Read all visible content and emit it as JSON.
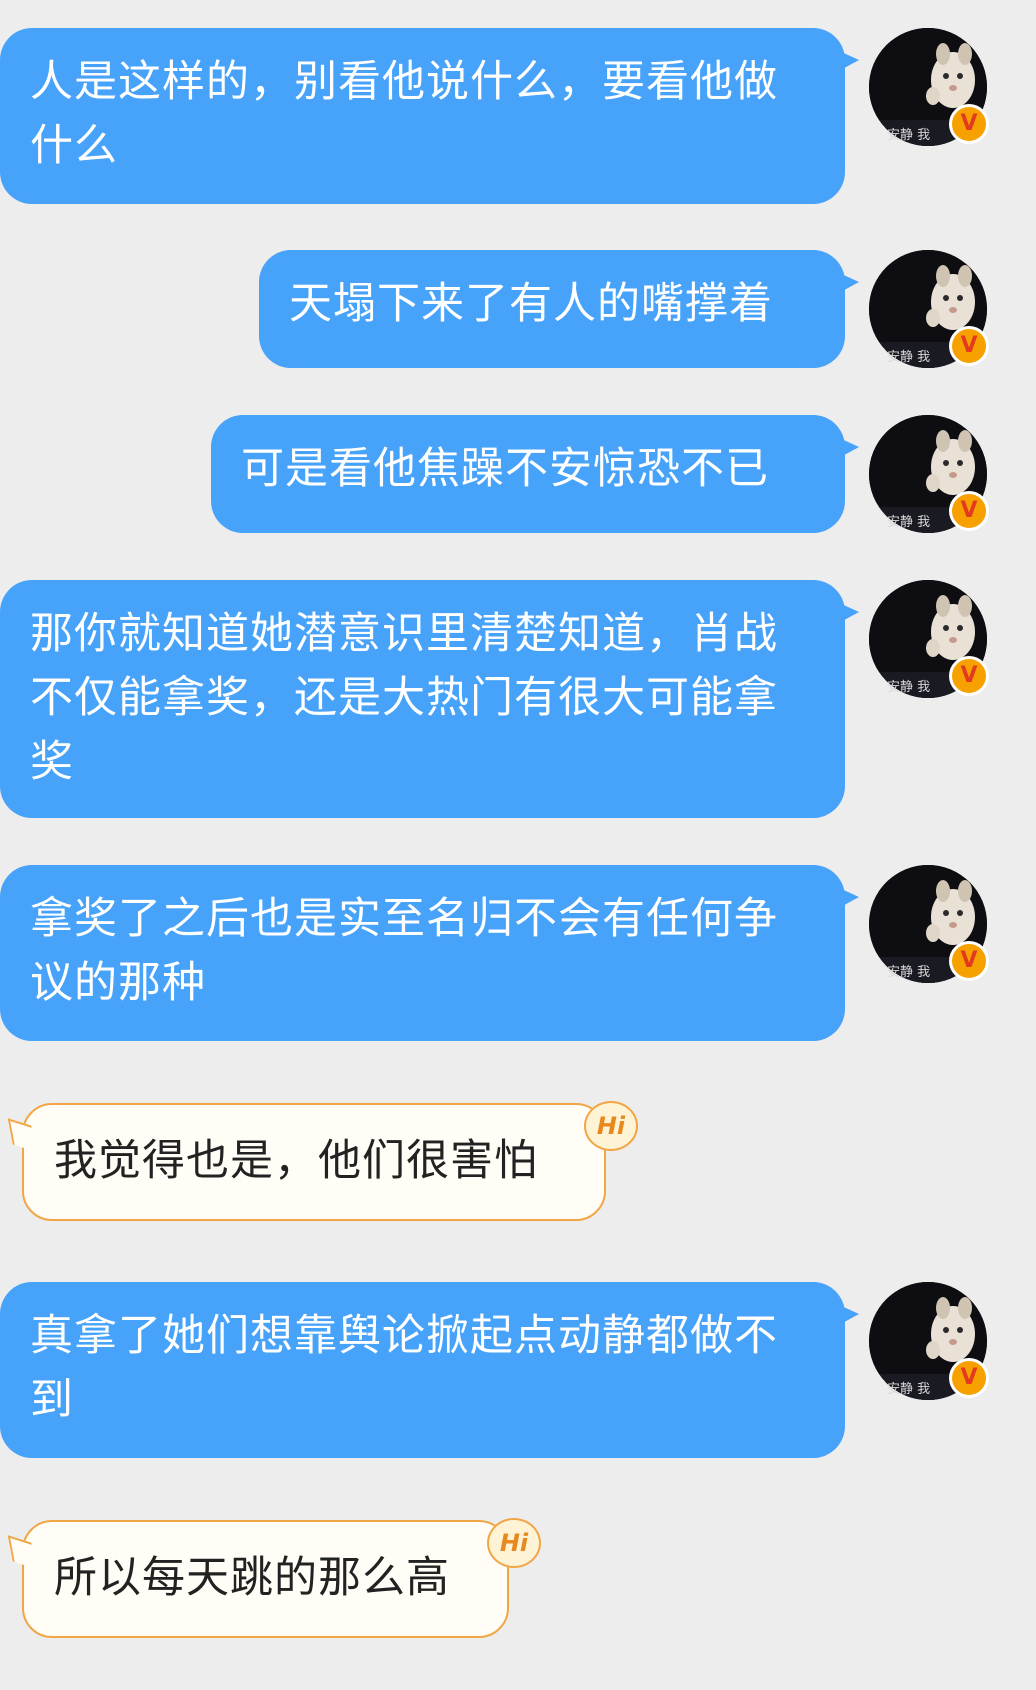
{
  "chat": {
    "messages": [
      {
        "sender": "self",
        "text": "人是这样的，别看他说什么，要看他做什么",
        "avatar": {
          "caption": "安静 我",
          "badge": "V",
          "icon": "cat-avatar-icon"
        }
      },
      {
        "sender": "self",
        "text": "天塌下来了有人的嘴撑着",
        "avatar": {
          "caption": "安静 我",
          "badge": "V",
          "icon": "cat-avatar-icon"
        }
      },
      {
        "sender": "self",
        "text": "可是看他焦躁不安惊恐不已",
        "avatar": {
          "caption": "安静 我",
          "badge": "V",
          "icon": "cat-avatar-icon"
        }
      },
      {
        "sender": "self",
        "text": "那你就知道她潜意识里清楚知道，肖战不仅能拿奖，还是大热门有很大可能拿奖",
        "avatar": {
          "caption": "安静 我",
          "badge": "V",
          "icon": "cat-avatar-icon"
        }
      },
      {
        "sender": "self",
        "text": "拿奖了之后也是实至名归不会有任何争议的那种",
        "avatar": {
          "caption": "安静 我",
          "badge": "V",
          "icon": "cat-avatar-icon"
        }
      },
      {
        "sender": "other",
        "text": "我觉得也是，他们很害怕",
        "badge": "Hi"
      },
      {
        "sender": "self",
        "text": "真拿了她们想靠舆论掀起点动静都做不到",
        "avatar": {
          "caption": "安静 我",
          "badge": "V",
          "icon": "cat-avatar-icon"
        }
      },
      {
        "sender": "other",
        "text": "所以每天跳的那么高",
        "badge": "Hi"
      }
    ]
  },
  "colors": {
    "background": "#ededed",
    "sent_bubble": "#47a2fa",
    "sent_text": "#ffffff",
    "received_bubble": "#fffdf6",
    "received_border": "#f1a645",
    "received_text": "#222222",
    "vip_badge": "#f7a100"
  }
}
